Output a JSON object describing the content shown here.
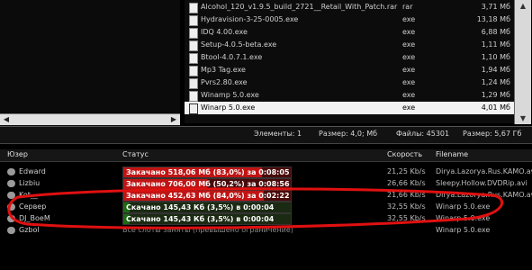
{
  "file_list": {
    "rows": [
      {
        "name": "Alcohol_120_v1.9.5_build_2721__Retail_With_Patch.rar",
        "ext": "rar",
        "size": "3,71 Мб",
        "selected": false
      },
      {
        "name": "Hydravision-3-25-0005.exe",
        "ext": "exe",
        "size": "13,18 Мб",
        "selected": false
      },
      {
        "name": "IDQ 4.00.exe",
        "ext": "exe",
        "size": "6,88 Мб",
        "selected": false
      },
      {
        "name": "Setup-4.0.5-beta.exe",
        "ext": "exe",
        "size": "1,11 Мб",
        "selected": false
      },
      {
        "name": "Btool-4.0.7.1.exe",
        "ext": "exe",
        "size": "1,10 Мб",
        "selected": false
      },
      {
        "name": "Mp3 Tag.exe",
        "ext": "exe",
        "size": "1,94 Мб",
        "selected": false
      },
      {
        "name": "Pvrs2.80.exe",
        "ext": "exe",
        "size": "1,24 Мб",
        "selected": false
      },
      {
        "name": "Winamp 5.0.exe",
        "ext": "exe",
        "size": "1,29 Мб",
        "selected": false
      },
      {
        "name": "Winarp 5.0.exe",
        "ext": "exe",
        "size": "4,01 Мб",
        "selected": true
      }
    ]
  },
  "statusbar": {
    "elements": "Элементы: 1",
    "size": "Размер: 4,0; Мб",
    "files": "Файлы: 45301",
    "total": "Размер: 5,67 Гб"
  },
  "downloads": {
    "headers": {
      "user": "Юзер",
      "status": "Статус",
      "speed": "Скорость",
      "filename": "Filename"
    },
    "rows": [
      {
        "user": "Edward",
        "kind": "bar",
        "color": "red",
        "progress": 0.83,
        "status": "Закачано 518,06 Мб (83,0%) за 0:08:05",
        "speed": "21,25 Kb/s",
        "filename": "Dirya.Lazorya.Rus.KAMO.avi"
      },
      {
        "user": "Lizbiu",
        "kind": "bar",
        "color": "red",
        "progress": 0.502,
        "status": "Закачано 706,00 Мб (50,2%) за 0:08:56",
        "speed": "26,66 Kb/s",
        "filename": "Sleepy.Hollow.DVDRip.avi"
      },
      {
        "user": "Kot__",
        "kind": "bar",
        "color": "red",
        "progress": 0.84,
        "status": "Закачано 452,63 Мб (84,0%) за 0:02:22",
        "speed": "21,66 Kb/s",
        "filename": "Dirya.Lazorya.Rus.KAMO.avi"
      },
      {
        "user": "Сервер",
        "kind": "bar",
        "color": "green",
        "progress": 0.035,
        "status": "Скачано 145,43 Кб (3,5%) в 0:00:04",
        "speed": "32,55 Kb/s",
        "filename": "Winarp 5.0.exe"
      },
      {
        "user": "DJ_BoeM",
        "kind": "bar",
        "color": "green",
        "progress": 0.035,
        "status": "Скачано 145,43 Кб (3,5%) в 0:00:04",
        "speed": "32,55 Kb/s",
        "filename": "Winarp 5.0.exe"
      },
      {
        "user": "Gzbol",
        "kind": "text",
        "status": "Все слоты заняты (превышено ограничение)",
        "speed": "",
        "filename": "Winarp 5.0.exe"
      }
    ]
  }
}
